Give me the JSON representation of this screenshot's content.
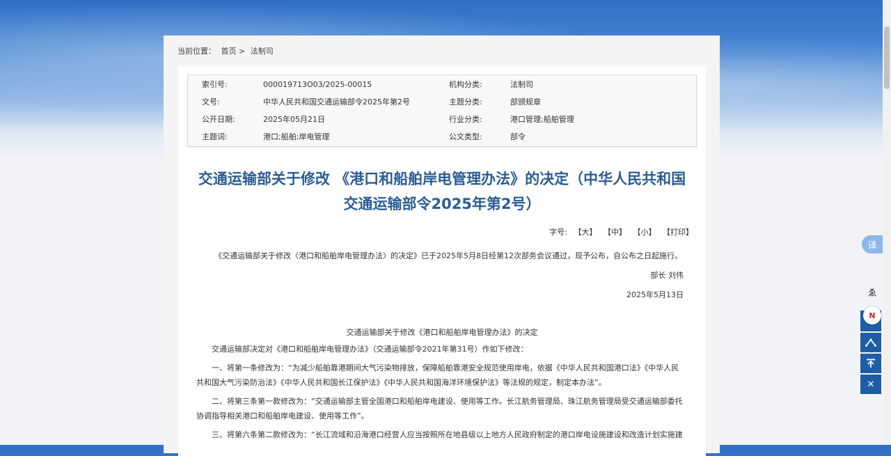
{
  "breadcrumb": {
    "prefix": "当前位置：",
    "home": "首页",
    "separator": ">",
    "current": "法制司"
  },
  "meta": {
    "rows": [
      {
        "l1": "索引号:",
        "v1": "000019713O03/2025-00015",
        "l2": "机构分类:",
        "v2": "法制司"
      },
      {
        "l1": "文号:",
        "v1": "中华人民共和国交通运输部令2025年第2号",
        "l2": "主题分类:",
        "v2": "部颁规章"
      },
      {
        "l1": "公开日期:",
        "v1": "2025年05月21日",
        "l2": "行业分类:",
        "v2": "港口管理;船舶管理"
      },
      {
        "l1": "主题词:",
        "v1": "港口;船舶;岸电管理",
        "l2": "公文类型:",
        "v2": "部令"
      }
    ]
  },
  "title": {
    "line1": "交通运输部关于修改 《港口和船舶岸电管理办法》的决定（中华人民共和国",
    "line2": "交通运输部令2025年第2号）"
  },
  "font_size": {
    "label": "字号:",
    "large": "【大】",
    "medium": "【中】",
    "small": "【小】",
    "print": "【打印】"
  },
  "article": {
    "intro": "《交通运输部关于修改〈港口和船舶岸电管理办法〉的决定》已于2025年5月8日经第12次部务会议通过，现予公布，自公布之日起施行。",
    "signer": "部长 刘伟",
    "date": "2025年5月13日",
    "decision_title": "交通运输部关于修改《港口和船舶岸电管理办法》的决定",
    "para1": "交通运输部决定对《港口和船舶岸电管理办法》（交通运输部令2021年第31号）作如下修改：",
    "para2a": "一、将第一条修改为：“为减少船舶靠港期间大气污染物排放，保障船舶靠港安全规范使用岸电，依据《中华人民共和国港口法》《中华人民",
    "para2b": "共和国大气污染防治法》《中华人民共和国长江保护法》《中华人民共和国海洋环境保护法》等法规的规定，制定本办法”。",
    "para3a": "二、将第三条第一款修改为：“交通运输部主管全国港口和船舶岸电建设、使用等工作。长江航务管理局、珠江航务管理局受交通运输部委托",
    "para3b": "协调指导相关港口和船舶岸电建设、使用等工作”。",
    "para4a": "三、将第六条第二款修改为：“长江流域和沿海港口经营人应当按照所在地县级以上地方人民政府制定的港口岸电设施建设和改造计划实施建"
  },
  "side_tools": {
    "translate": "译",
    "access": "ゑ",
    "logo": "N",
    "share": "share-icon",
    "top": "back-to-top-icon",
    "close": "close-icon"
  }
}
